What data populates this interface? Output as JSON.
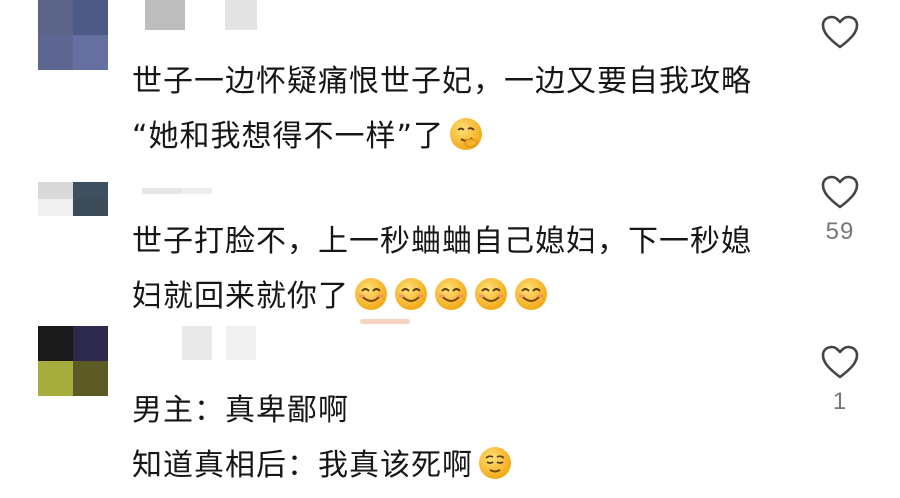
{
  "comments": [
    {
      "text_lines": [
        "世子一边怀疑痛恨世子妃，一边又要自我攻略",
        "“她和我想得不一样”了"
      ],
      "emoji_icons": [
        "thinking-smirk-emoji"
      ],
      "like_count": "",
      "liked": false
    },
    {
      "text_lines": [
        "世子打脸不，上一秒蛐蛐自己媳妇，下一秒媳",
        "妇就回来就你了"
      ],
      "emoji_icons": [
        "smiling-emoji",
        "smiling-emoji",
        "smiling-emoji",
        "smiling-emoji",
        "smiling-emoji"
      ],
      "like_count": "59",
      "liked": false
    },
    {
      "text_lines": [
        "男主：真卑鄙啊",
        "知道真相后：我真该死啊"
      ],
      "emoji_icons": [
        "relieved-emoji"
      ],
      "like_count": "1",
      "liked": false
    }
  ],
  "colors": {
    "text": "#161616",
    "like_icon": "#444444",
    "like_count": "#777777",
    "emoji_face": "#F7C23B",
    "emoji_face_dark": "#E89B1C"
  },
  "icons": {
    "like": "heart-outline-icon"
  }
}
